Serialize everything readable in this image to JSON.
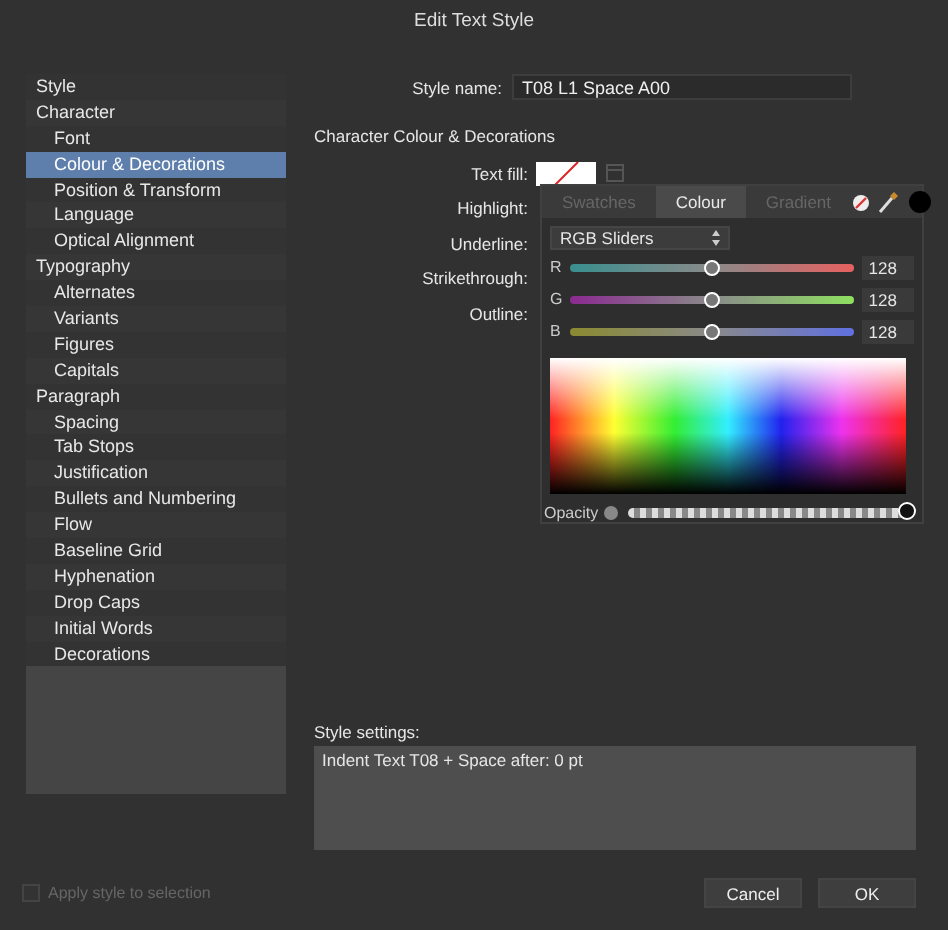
{
  "window": {
    "title": "Edit Text Style"
  },
  "sidebar": {
    "items": [
      {
        "label": "Style",
        "selected": false
      },
      {
        "label": "Character",
        "selected": false,
        "children": [
          {
            "label": "Font",
            "selected": false
          },
          {
            "label": "Colour & Decorations",
            "selected": true
          },
          {
            "label": "Position & Transform",
            "selected": false
          },
          {
            "label": "Language",
            "selected": false
          },
          {
            "label": "Optical Alignment",
            "selected": false
          }
        ]
      },
      {
        "label": "Typography",
        "selected": false,
        "children": [
          {
            "label": "Alternates",
            "selected": false
          },
          {
            "label": "Variants",
            "selected": false
          },
          {
            "label": "Figures",
            "selected": false
          },
          {
            "label": "Capitals",
            "selected": false
          }
        ]
      },
      {
        "label": "Paragraph",
        "selected": false,
        "children": [
          {
            "label": "Spacing",
            "selected": false
          },
          {
            "label": "Tab Stops",
            "selected": false
          },
          {
            "label": "Justification",
            "selected": false
          },
          {
            "label": "Bullets and Numbering",
            "selected": false
          },
          {
            "label": "Flow",
            "selected": false
          },
          {
            "label": "Baseline Grid",
            "selected": false
          },
          {
            "label": "Hyphenation",
            "selected": false
          },
          {
            "label": "Drop Caps",
            "selected": false
          },
          {
            "label": "Initial Words",
            "selected": false
          },
          {
            "label": "Decorations",
            "selected": false
          }
        ]
      }
    ]
  },
  "style_name": {
    "label": "Style name:",
    "value": "T08 L1 Space A00"
  },
  "section_title": "Character Colour & Decorations",
  "fields": [
    "Text fill:",
    "Highlight:",
    "Underline:",
    "Strikethrough:",
    "Outline:"
  ],
  "colour_popover": {
    "tabs": [
      {
        "label": "Swatches",
        "selected": false
      },
      {
        "label": "Colour",
        "selected": true
      },
      {
        "label": "Gradient",
        "selected": false
      }
    ],
    "mode": "RGB Sliders",
    "channels": [
      {
        "name": "R",
        "level": 0.5,
        "reading": "128"
      },
      {
        "name": "G",
        "level": 0.5,
        "reading": "128"
      },
      {
        "name": "B",
        "level": 0.5,
        "reading": "128"
      }
    ],
    "opacity": {
      "label": "Opacity",
      "level": 1
    }
  },
  "style_settings": {
    "label": "Style settings:",
    "value": "Indent Text T08 + Space after: 0 pt"
  },
  "apply_to_selection": {
    "label": "Apply style to selection",
    "checked": false,
    "disabled": true
  },
  "buttons": [
    "Cancel",
    "OK"
  ]
}
